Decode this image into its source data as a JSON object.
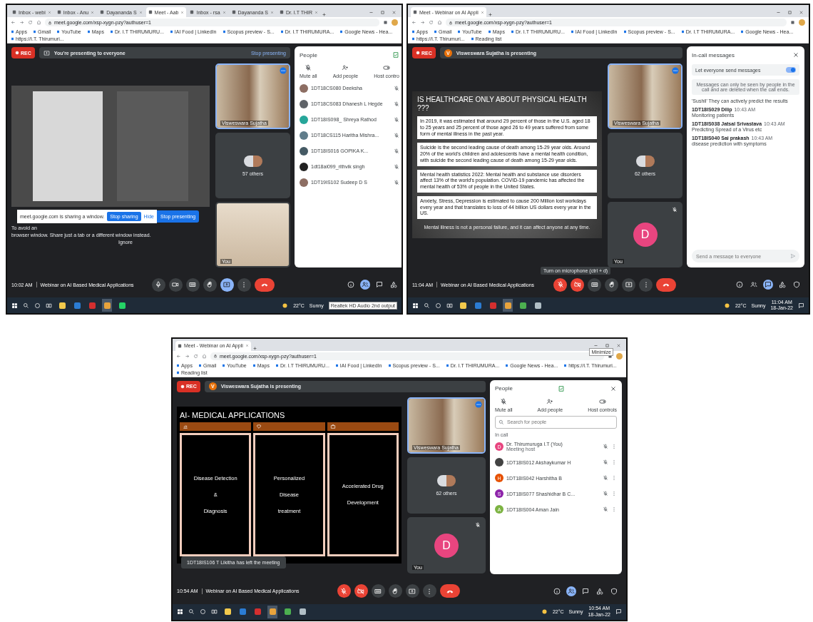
{
  "panels": [
    {
      "browser": {
        "tabs": [
          {
            "title": "Inbox - webi",
            "selected": false
          },
          {
            "title": "Inbox - Anu",
            "selected": false
          },
          {
            "title": "Dayananda S",
            "selected": false
          },
          {
            "title": "Meet - Aab",
            "selected": true
          },
          {
            "title": "Inbox - rsa",
            "selected": false
          },
          {
            "title": "Dayananda S",
            "selected": false
          },
          {
            "title": "Dr. I.T THIR",
            "selected": false
          }
        ],
        "url": "meet.google.com/xsp-xygn-pzy?authuser=1",
        "bookmarks": [
          "Apps",
          "Gmail",
          "YouTube",
          "Maps",
          "Dr. I.T THIRUMURU...",
          "IAI Food | LinkedIn",
          "Scopus preview - S...",
          "Dr. I.T THIRUMURA...",
          "Google News - Hea...",
          "https://I.T. Thirumuri..."
        ]
      },
      "meet": {
        "rec": "REC",
        "banner": {
          "kind": "self",
          "text": "You're presenting to everyone",
          "action": "Stop presenting"
        },
        "stage": {
          "kind": "screen-share",
          "popup_text": "meet.google.com is sharing a window.",
          "popup_button": "Stop sharing",
          "popup_link": "Hide",
          "present_button": "Stop presenting",
          "warning_lines": [
            "To avoid an",
            "browser window. Share just a tab or a different window instead."
          ],
          "ignore": "Ignore"
        },
        "tiles": [
          {
            "kind": "video",
            "label": "Visweswara Sujatha",
            "selected": true
          },
          {
            "kind": "group",
            "label": "57 others",
            "selected": false
          },
          {
            "kind": "self-video",
            "label": "You",
            "selected": false
          }
        ],
        "side": {
          "kind": "people",
          "title": "People",
          "closable": false,
          "actions": [
            {
              "kind": "mute",
              "label": "Mute all"
            },
            {
              "kind": "add",
              "label": "Add people"
            },
            {
              "kind": "host",
              "label": "Host contro"
            }
          ],
          "people": [
            {
              "name": "1DT18CS080 Deeksha",
              "color": "#8d6e63"
            },
            {
              "name": "1DT18CS083 Dhanesh L Hegde",
              "color": "#5f6368"
            },
            {
              "name": "1DT18IS098_ Shreya Rathod",
              "color": "#26a69a"
            },
            {
              "name": "1DT18CS115 Haritha Mishra...",
              "color": "#607d8b"
            },
            {
              "name": "1DT18IS016 GOPIKA K...",
              "color": "#455a64"
            },
            {
              "name": "1dt18ai099_rithvik singh",
              "color": "#212121"
            },
            {
              "name": "1DT19IS102 Sudeep D S",
              "color": "#8d6e63"
            }
          ]
        },
        "meeting_time": "10:02 AM",
        "meeting_title": "Webinar on AI Based Medical Applications",
        "controls": [
          {
            "kind": "mic",
            "off": false,
            "selected": false
          },
          {
            "kind": "camera",
            "off": false,
            "selected": false
          },
          {
            "kind": "captions",
            "off": false,
            "selected": false
          },
          {
            "kind": "hand",
            "off": false,
            "selected": false
          },
          {
            "kind": "present",
            "off": false,
            "selected": true
          },
          {
            "kind": "more",
            "off": false,
            "selected": false
          },
          {
            "kind": "hangup",
            "off": false,
            "selected": false
          }
        ],
        "side_buttons": [
          {
            "kind": "info",
            "selected": false
          },
          {
            "kind": "people",
            "selected": true
          },
          {
            "kind": "chat",
            "selected": false
          },
          {
            "kind": "activities",
            "selected": false
          }
        ]
      },
      "taskbar": {
        "apps": [
          {
            "kind": "explorer",
            "selected": false
          },
          {
            "kind": "word",
            "selected": false
          },
          {
            "kind": "acrobat",
            "selected": false
          },
          {
            "kind": "chrome",
            "selected": true
          },
          {
            "kind": "whatsapp",
            "selected": false
          }
        ],
        "temperature": "22°C",
        "weather": "Sunny",
        "tooltip": "Realtek HD Audio 2nd output"
      }
    },
    {
      "browser": {
        "tabs": [
          {
            "title": "Meet - Webinar on AI Appli",
            "selected": true
          }
        ],
        "url": "meet.google.com/xsp-xygn-pzy?authuser=1",
        "bookmarks": [
          "Apps",
          "Gmail",
          "YouTube",
          "Maps",
          "Dr. I.T THIRUMURU...",
          "IAI Food | LinkedIn",
          "Scopus preview - S...",
          "Dr. I.T THIRUMURA...",
          "Google News - Hea...",
          "https://I.T. Thirumuri...",
          "Reading list"
        ]
      },
      "meet": {
        "rec": "REC",
        "banner": {
          "kind": "other",
          "avatar": "V",
          "text": "Visweswara Sujatha is presenting"
        },
        "stage": {
          "kind": "slide-text",
          "title": "IS HEALTHCARE ONLY ABOUT PHYSICAL HEALTH ???",
          "paragraphs": [
            "In 2019, it was estimated that around 29 percent of those in the U.S. aged 18 to 25 years and 25 percent of those aged 26 to 49 years suffered from some form of mental illness in the past year.",
            "Suicide is the second leading cause of death among 15-29 year olds. Around 20% of the world's children and adolescents have a mental health condition, with suicide the second leading cause of death among 15-29 year olds.",
            "Mental health statistics 2022: Mental health and substance use disorders affect 13% of the world's population. COVID-19 pandemic has affected the mental health of 53% of people in the United States.",
            "Anxiety, Stress, Depression is estimated to cause 200 Million lost workdays every year and that translates to loss of 44 billion US dollars every year in the US."
          ],
          "caption": "Mental illness is not a personal failure, and it can affect anyone at any time."
        },
        "tiles": [
          {
            "kind": "video",
            "label": "Visweswara Sujatha",
            "selected": true
          },
          {
            "kind": "group",
            "label": "62 others",
            "selected": false
          },
          {
            "kind": "self-avatar",
            "avatar": "D",
            "color": "#e8457f",
            "label": "You",
            "selected": false
          }
        ],
        "side": {
          "kind": "messages",
          "title": "In-call messages",
          "closable": true,
          "toggle_label": "Let everyone send messages",
          "toggle_on": true,
          "notice": "Messages can only be seen by people in the call and are deleted when the call ends.",
          "messages": [
            {
              "text": "'Sushil' They can actively predict the results"
            },
            {
              "sender": "1DT18IS029 Dilip",
              "time": "10:43 AM",
              "text": "Monitoring patients"
            },
            {
              "sender": "1DT18IS038 Jatsal Srivastava",
              "time": "10:43 AM",
              "text": "Predicting Spread of a Virus etc"
            },
            {
              "sender": "1DT18IS040 Sai prakash",
              "time": "10:43 AM",
              "text": "disease prediction with symptoms"
            }
          ],
          "placeholder": "Send a message to everyone"
        },
        "meeting_time": "11:04 AM",
        "meeting_title": "Webinar on AI Based Medical Applications",
        "controls_tooltip": "Turn on microphone (ctrl + d)",
        "controls": [
          {
            "kind": "mic",
            "off": true,
            "selected": false
          },
          {
            "kind": "camera",
            "off": true,
            "selected": false
          },
          {
            "kind": "captions",
            "off": false,
            "selected": false
          },
          {
            "kind": "hand",
            "off": false,
            "selected": false
          },
          {
            "kind": "present",
            "off": false,
            "selected": false
          },
          {
            "kind": "more",
            "off": false,
            "selected": false
          },
          {
            "kind": "hangup",
            "off": false,
            "selected": false
          }
        ],
        "side_buttons": [
          {
            "kind": "info",
            "selected": false
          },
          {
            "kind": "people",
            "selected": false
          },
          {
            "kind": "chat",
            "selected": true
          },
          {
            "kind": "activities",
            "selected": false
          },
          {
            "kind": "host",
            "selected": false
          }
        ]
      },
      "taskbar": {
        "apps": [
          {
            "kind": "explorer",
            "selected": false
          },
          {
            "kind": "word",
            "selected": false
          },
          {
            "kind": "acrobat",
            "selected": false
          },
          {
            "kind": "chrome",
            "selected": true
          },
          {
            "kind": "chrome-alt",
            "selected": false
          },
          {
            "kind": "paint",
            "selected": false
          }
        ],
        "temperature": "22°C",
        "weather": "Sunny",
        "clock_time": "11:04 AM",
        "clock_date": "18-Jan-22"
      }
    },
    {
      "browser": {
        "tabs": [
          {
            "title": "Meet - Webinar on AI Appli",
            "selected": true
          }
        ],
        "url": "meet.google.com/xsp-xygn-pzy?authuser=1",
        "tooltip": "Minimize",
        "bookmarks": [
          "Apps",
          "Gmail",
          "YouTube",
          "Maps",
          "Dr. I.T THIRUMURU...",
          "IAI Food | LinkedIn",
          "Scopus preview - S...",
          "Dr. I.T THIRUMURA...",
          "Google News - Hea...",
          "https://I.T. Thirumuri...",
          "Reading list"
        ]
      },
      "meet": {
        "rec": "REC",
        "banner": {
          "kind": "other",
          "avatar": "V",
          "text": "Visweswara Sujatha is presenting"
        },
        "stage": {
          "kind": "slide-cards",
          "title": "AI- MEDICAL APPLICATIONS",
          "cards": [
            {
              "lines": [
                "Disease Detection",
                "&",
                "Diagnosis"
              ]
            },
            {
              "lines": [
                "Personalized",
                "Disease",
                "treatment"
              ]
            },
            {
              "lines": [
                "Accelerated Drug",
                "Development"
              ]
            }
          ],
          "toast": "1DT18IS106 T Likitha has left the meeting"
        },
        "tiles": [
          {
            "kind": "video",
            "label": "Visweswara Sujatha",
            "selected": true
          },
          {
            "kind": "group",
            "label": "62 others",
            "selected": false
          },
          {
            "kind": "self-avatar",
            "avatar": "D",
            "color": "#e8457f",
            "label": "You",
            "selected": false
          }
        ],
        "side": {
          "kind": "people",
          "title": "People",
          "closable": true,
          "actions": [
            {
              "kind": "mute",
              "label": "Mute all"
            },
            {
              "kind": "add",
              "label": "Add people"
            },
            {
              "kind": "host",
              "label": "Host controls"
            }
          ],
          "search_placeholder": "Search for people",
          "section": "In call",
          "people": [
            {
              "name": "Dr. Thirumuruga I.T (You)",
              "role": "Meeting host",
              "avatar": "D",
              "color": "#e8457f"
            },
            {
              "name": "1DT18IS012 Akshaykumar H",
              "color": "#424242"
            },
            {
              "name": "1DT18IS042 Harshitha B",
              "avatar": "H",
              "color": "#e65100"
            },
            {
              "name": "1DT18IS077 Shashidhar B C...",
              "avatar": "S",
              "color": "#8e24aa"
            },
            {
              "name": "1DT18IS004 Aman Jain",
              "avatar": "A",
              "color": "#7cb342"
            }
          ]
        },
        "meeting_time": "10:54 AM",
        "meeting_title": "Webinar on AI Based Medical Applications",
        "controls": [
          {
            "kind": "mic",
            "off": true,
            "selected": false
          },
          {
            "kind": "camera",
            "off": true,
            "selected": false
          },
          {
            "kind": "captions",
            "off": false,
            "selected": false
          },
          {
            "kind": "hand",
            "off": false,
            "selected": false
          },
          {
            "kind": "present",
            "off": false,
            "selected": false
          },
          {
            "kind": "more",
            "off": false,
            "selected": false
          },
          {
            "kind": "hangup",
            "off": false,
            "selected": false
          }
        ],
        "side_buttons": [
          {
            "kind": "info",
            "selected": false
          },
          {
            "kind": "people",
            "selected": true
          },
          {
            "kind": "chat",
            "selected": false
          },
          {
            "kind": "activities",
            "selected": false
          },
          {
            "kind": "host",
            "selected": false
          }
        ]
      },
      "taskbar": {
        "apps": [
          {
            "kind": "explorer",
            "selected": false
          },
          {
            "kind": "word",
            "selected": false
          },
          {
            "kind": "acrobat",
            "selected": false
          },
          {
            "kind": "chrome",
            "selected": true
          },
          {
            "kind": "chrome-alt",
            "selected": false
          },
          {
            "kind": "paint",
            "selected": false
          }
        ],
        "temperature": "22°C",
        "weather": "Sunny",
        "clock_time": "10:54 AM",
        "clock_date": "18-Jan-22"
      }
    }
  ]
}
